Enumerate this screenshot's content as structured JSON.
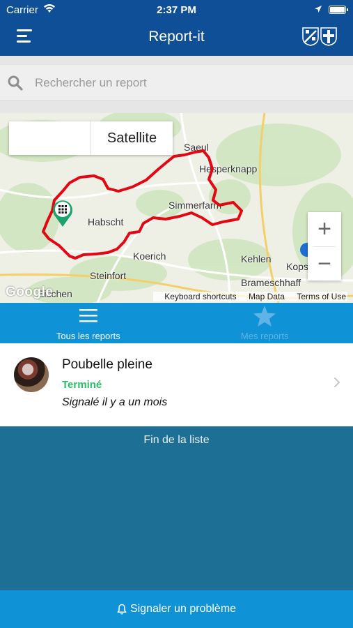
{
  "status": {
    "carrier": "Carrier",
    "time": "2:37 PM"
  },
  "app": {
    "title": "Report-it"
  },
  "search": {
    "placeholder": "Rechercher un report"
  },
  "map": {
    "type_options": [
      "",
      "Satellite"
    ],
    "places": [
      "Saeul",
      "Hesperknapp",
      "Habscht",
      "Simmerfarm",
      "Koerich",
      "Kehlen",
      "Steinfort",
      "Kopstal",
      "Brameschhaff",
      "Eischen"
    ],
    "attribution": "Google",
    "footer_links": [
      "Keyboard shortcuts",
      "Map Data",
      "Terms of Use"
    ],
    "zoom_in": "+",
    "zoom_out": "−",
    "route_color": "#e30613"
  },
  "tabs": [
    {
      "label": "Tous les reports",
      "icon": "list-icon",
      "active": true
    },
    {
      "label": "Mes reports",
      "icon": "star-icon",
      "active": false
    }
  ],
  "reports": [
    {
      "title": "Poubelle pleine",
      "status": "Terminé",
      "date": "Signalé il y a un mois",
      "status_color": "#2dbd68"
    }
  ],
  "list_end": "Fin de la liste",
  "action": {
    "label": "Signaler un problème",
    "icon": "bell-icon"
  },
  "colors": {
    "nav": "#0e4f97",
    "accent": "#0f92d6",
    "background": "#1d6f96"
  }
}
